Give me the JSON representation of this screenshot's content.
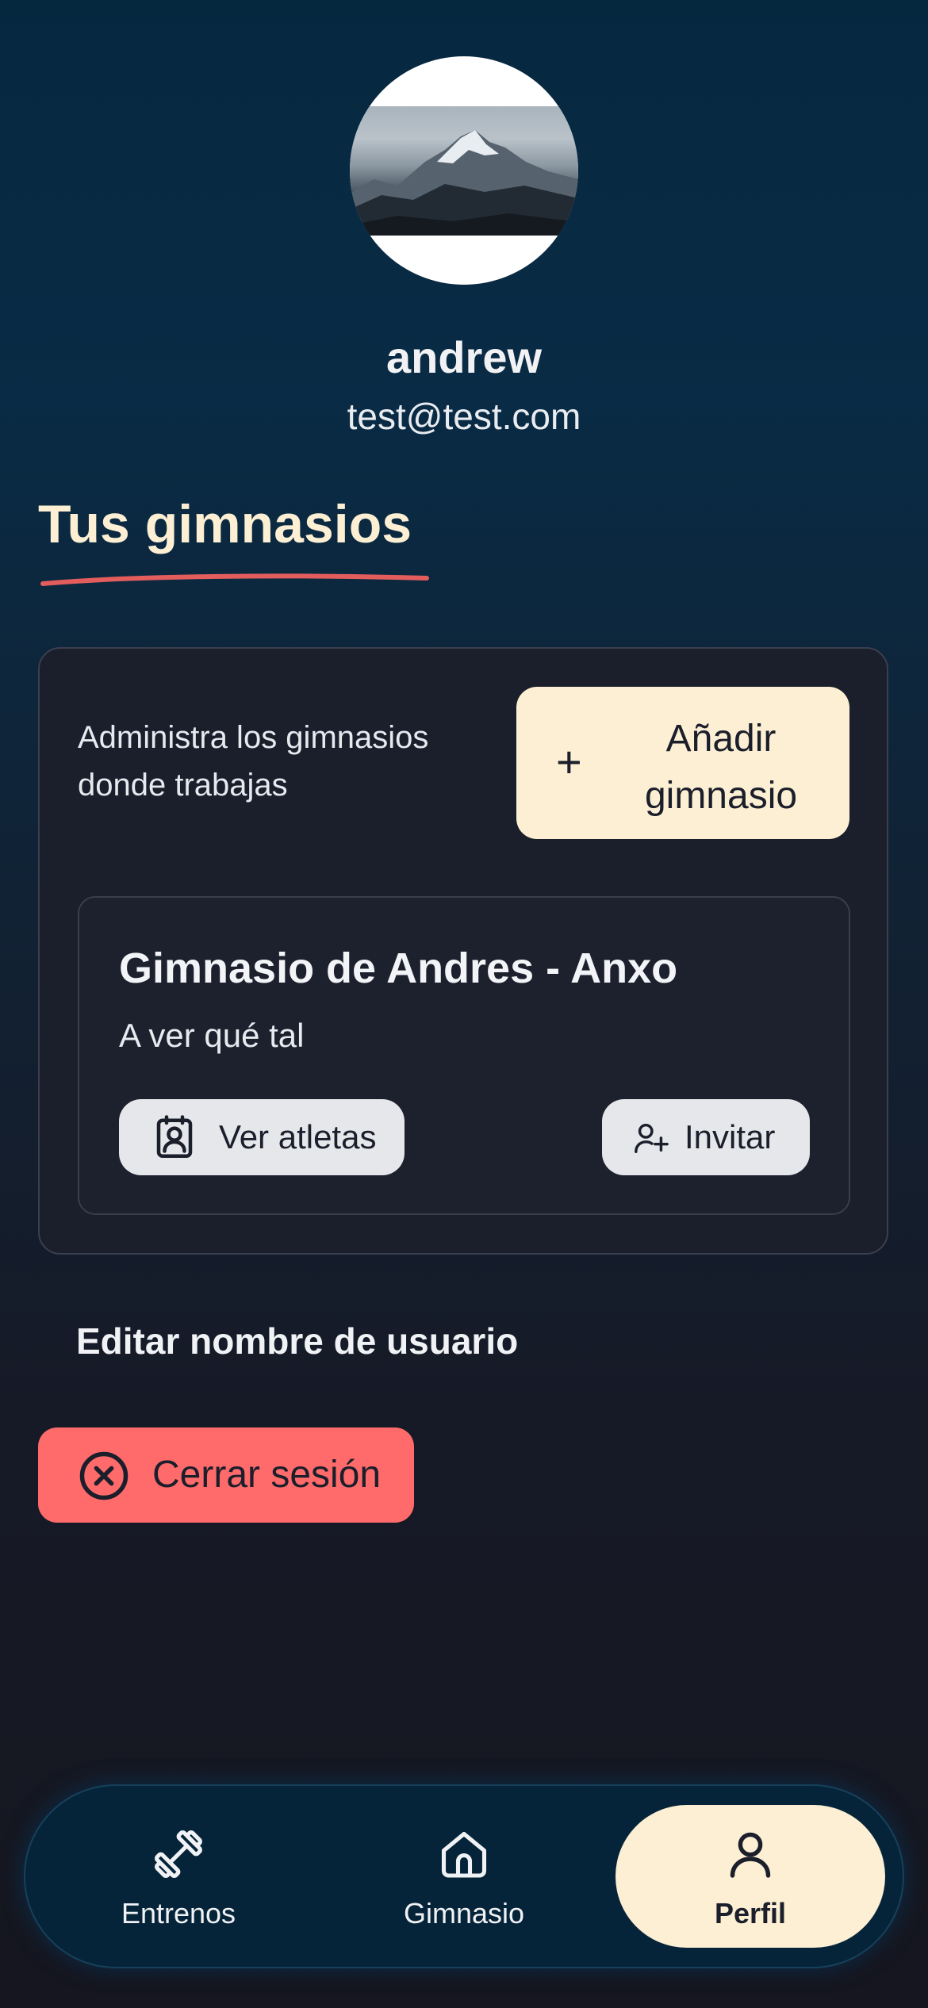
{
  "profile": {
    "name": "andrew",
    "email": "test@test.com",
    "avatar_icon": "mountain-photo"
  },
  "gyms_section": {
    "title": "Tus gimnasios",
    "description": "Administra los gimnasios donde trabajas",
    "add_button_label": "Añadir gimnasio",
    "add_button_icon": "plus-icon",
    "gyms": [
      {
        "name": "Gimnasio de Andres - Anxo",
        "description": "A ver qué tal",
        "view_athletes_label": "Ver atletas",
        "invite_label": "Invitar"
      }
    ]
  },
  "edit_username_label": "Editar nombre de usuario",
  "logout_label": "Cerrar sesión",
  "bottom_nav": {
    "items": [
      {
        "label": "Entrenos",
        "icon": "dumbbell-icon",
        "active": false
      },
      {
        "label": "Gimnasio",
        "icon": "home-icon",
        "active": false
      },
      {
        "label": "Perfil",
        "icon": "user-icon",
        "active": true
      }
    ]
  },
  "colors": {
    "accent_cream": "#fcefd3",
    "danger_red": "#ff6b6b",
    "underline_red": "#e35d5d",
    "card_bg": "#1b1e2b",
    "nav_bg": "#062439"
  }
}
